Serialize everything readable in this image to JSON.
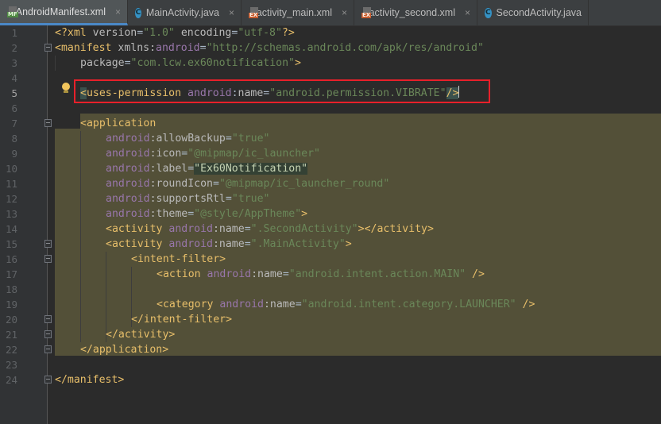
{
  "tabs": [
    {
      "label": "AndroidManifest.xml",
      "icon": "manifest-xml-file-icon",
      "active": true,
      "closable": true
    },
    {
      "label": "MainActivity.java",
      "icon": "java-class-file-icon",
      "closable": true
    },
    {
      "label": "activity_main.xml",
      "icon": "layout-xml-file-icon",
      "closable": true
    },
    {
      "label": "activity_second.xml",
      "icon": "layout-xml-file-icon",
      "closable": true
    },
    {
      "label": "SecondActivity.java",
      "icon": "java-class-file-icon",
      "closable": false
    }
  ],
  "tab_icon_text": {
    "manifest": "MF",
    "layout": "EX",
    "java_class": "C"
  },
  "close_glyph": "×",
  "line_numbers": [
    "1",
    "2",
    "3",
    "4",
    "5",
    "6",
    "7",
    "8",
    "9",
    "10",
    "11",
    "12",
    "13",
    "14",
    "15",
    "16",
    "17",
    "18",
    "19",
    "20",
    "21",
    "22",
    "23",
    "24"
  ],
  "colors": {
    "background": "#2b2b2b",
    "gutter": "#313335",
    "tag": "#e8bf6a",
    "namespace": "#9876aa",
    "attribute": "#bababa",
    "value": "#6a8759",
    "text": "#a9b7c6",
    "block_highlight": "#535038",
    "callout_border": "#e8202a"
  },
  "code": {
    "l1": {
      "open": "<?xml ",
      "a1": "version",
      "eq1": "=",
      "v1": "\"1.0\"",
      "sp": " ",
      "a2": "encoding",
      "eq2": "=",
      "v2": "\"utf-8\"",
      "close": "?>"
    },
    "l2": {
      "tag": "<manifest ",
      "a1": "xmlns:",
      "ns": "android",
      "eq": "=",
      "v": "\"http://schemas.android.com/apk/res/android\""
    },
    "l3": {
      "a": "package",
      "eq": "=",
      "v": "\"com.lcw.ex60notification\"",
      "close": ">"
    },
    "l5": {
      "lt": "<",
      "tag": "uses-permission ",
      "ns": "android",
      "colon": ":",
      "a": "name",
      "eq": "=",
      "v": "\"android.permission.VIBRATE\"",
      "close": "/>"
    },
    "l7": {
      "tag": "<application"
    },
    "l8": {
      "ns": "android",
      "a": ":allowBackup",
      "eq": "=",
      "v": "\"true\""
    },
    "l9": {
      "ns": "android",
      "a": ":icon",
      "eq": "=",
      "v": "\"@mipmap/ic_launcher\""
    },
    "l10": {
      "ns": "android",
      "a": ":label",
      "eq": "=",
      "v": "\"Ex60Notification\""
    },
    "l11": {
      "ns": "android",
      "a": ":roundIcon",
      "eq": "=",
      "v": "\"@mipmap/ic_launcher_round\""
    },
    "l12": {
      "ns": "android",
      "a": ":supportsRtl",
      "eq": "=",
      "v": "\"true\""
    },
    "l13": {
      "ns": "android",
      "a": ":theme",
      "eq": "=",
      "v": "\"@style/AppTheme\"",
      "close": ">"
    },
    "l14": {
      "tag": "<activity ",
      "ns": "android",
      "a": ":name",
      "eq": "=",
      "v": "\".SecondActivity\"",
      "close": "></activity>"
    },
    "l15": {
      "tag": "<activity ",
      "ns": "android",
      "a": ":name",
      "eq": "=",
      "v": "\".MainActivity\"",
      "close": ">"
    },
    "l16": {
      "tag": "<intent-filter>"
    },
    "l17": {
      "tag": "<action ",
      "ns": "android",
      "a": ":name",
      "eq": "=",
      "v": "\"android.intent.action.MAIN\"",
      "close": " />"
    },
    "l19": {
      "tag": "<category ",
      "ns": "android",
      "a": ":name",
      "eq": "=",
      "v": "\"android.intent.category.LAUNCHER\"",
      "close": " />"
    },
    "l20": {
      "tag": "</intent-filter>"
    },
    "l21": {
      "tag": "</activity>"
    },
    "l22": {
      "tag": "</application>"
    },
    "l24": {
      "tag": "</manifest>"
    }
  }
}
